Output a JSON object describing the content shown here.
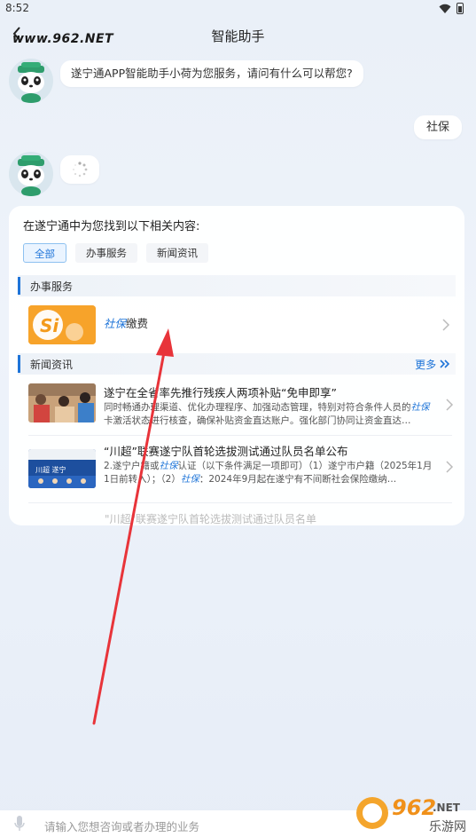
{
  "status_bar": {
    "time": "8:52"
  },
  "header": {
    "title": "智能助手",
    "watermark": "www.962.NET"
  },
  "chat": {
    "bot_greeting": "遂宁通APP智能助手小荷为您服务，请问有什么可以帮您?",
    "user_message": "社保"
  },
  "results": {
    "heading": "在遂宁通中为您找到以下相关内容:",
    "tabs": [
      "全部",
      "办事服务",
      "新闻资讯"
    ],
    "services_section": "办事服务",
    "service_item": {
      "keyword": "社保",
      "rest": "缴费"
    },
    "news_section": "新闻资讯",
    "more_label": "更多",
    "news": [
      {
        "title": "遂宁在全省率先推行残疾人两项补贴“免申即享”",
        "desc_before": "同时畅通办理渠道、优化办理程序、加强动态管理，特别对符合条件人员的",
        "desc_kw": "社保",
        "desc_after": "卡激活状态进行核查，确保补贴资金直达账户。强化部门协同让资金直达…"
      },
      {
        "title": "“川超”联赛遂宁队首轮选拔测试通过队员名单公布",
        "desc_p1": "2.遂宁户籍或",
        "desc_kw1": "社保",
        "desc_p2": "认证（以下条件满足一项即可）（1）遂宁市户籍（2025年1月1日前转入）；（2）",
        "desc_kw2": "社保",
        "desc_p3": "：2024年9月起在遂宁有不间断社会保险缴纳…"
      }
    ],
    "truncated_text": "\"川超\"联赛遂宁队首轮选拔测试通过队员名单"
  },
  "input": {
    "placeholder": "请输入您想咨询或者办理的业务"
  },
  "colors": {
    "accent": "#1e74d8",
    "arrow": "#e8343a",
    "service_icon": "#f7a32a"
  }
}
